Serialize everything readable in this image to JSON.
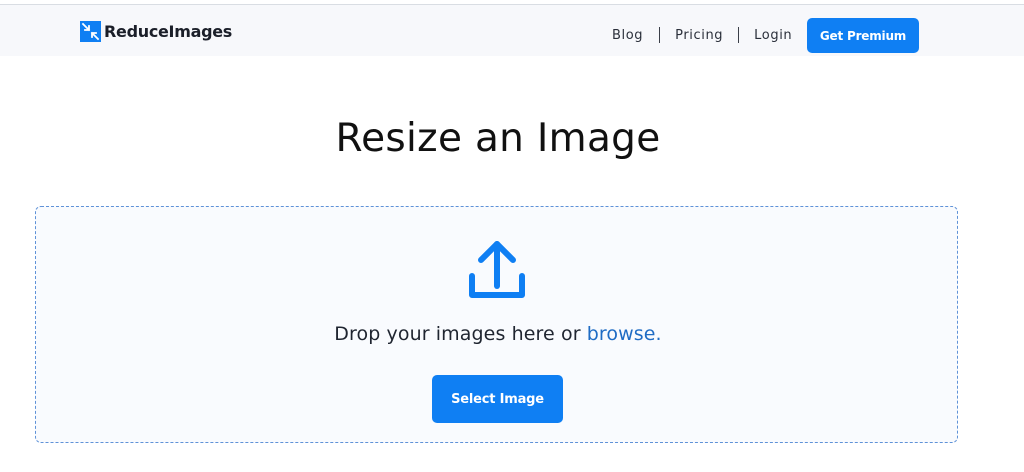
{
  "header": {
    "brand": "ReduceImages",
    "nav": {
      "blog": "Blog",
      "pricing": "Pricing",
      "login": "Login"
    },
    "premium_label": "Get Premium"
  },
  "main": {
    "title": "Resize an Image",
    "drop_text": "Drop your images here or ",
    "browse_label": "browse.",
    "select_label": "Select Image"
  },
  "icons": {
    "logo": "reduce-images-logo-icon",
    "upload": "upload-icon"
  },
  "colors": {
    "accent": "#0f7ff3",
    "link": "#1f6cc4",
    "dashed_border": "#5f92d8"
  }
}
